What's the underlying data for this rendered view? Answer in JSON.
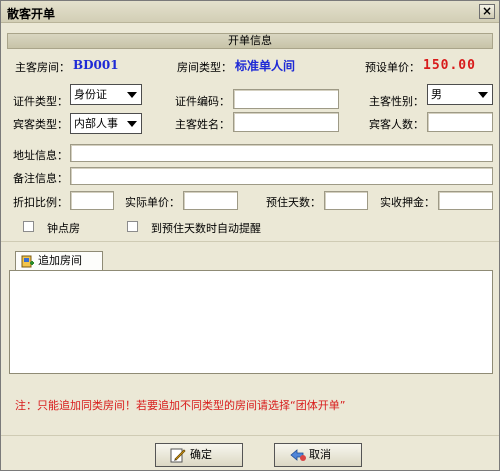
{
  "window": {
    "title": "散客开单",
    "close_symbol": "×"
  },
  "section": {
    "title": "开单信息"
  },
  "room_summary": {
    "room_label": "主客房间：",
    "room_value": "BD001",
    "type_label": "房间类型：",
    "type_value": "标准单人间",
    "price_label": "预设单价：",
    "price_value": "150.00"
  },
  "form": {
    "id_type_label": "证件类型：",
    "id_type_value": "身份证",
    "id_number_label": "证件编码：",
    "id_number_value": "",
    "gender_label": "主客性别：",
    "gender_value": "男",
    "guest_type_label": "宾客类型：",
    "guest_type_value": "内部人事",
    "guest_name_label": "主客姓名：",
    "guest_name_value": "",
    "guest_count_label": "宾客人数：",
    "guest_count_value": "",
    "address_label": "地址信息：",
    "address_value": "",
    "remark_label": "备注信息：",
    "remark_value": "",
    "discount_label": "折扣比例：",
    "discount_value": "",
    "actual_price_label": "实际单价：",
    "actual_price_value": "",
    "days_label": "预住天数：",
    "days_value": "",
    "deposit_label": "实收押金：",
    "deposit_value": "",
    "hourly_label": "钟点房",
    "hourly_checked": false,
    "remind_label": "到预住天数时自动提醒",
    "remind_checked": false
  },
  "tabs": {
    "add_room_label": "追加房间"
  },
  "note": "注：只能追加同类房间！若要追加不同类型的房间请选择“团体开单”",
  "buttons": {
    "ok_label": "确定",
    "cancel_label": "取消"
  },
  "colors": {
    "accent_blue": "#1e2ad6",
    "accent_red": "#d81b1b",
    "window_bg": "#ebe8d6"
  }
}
